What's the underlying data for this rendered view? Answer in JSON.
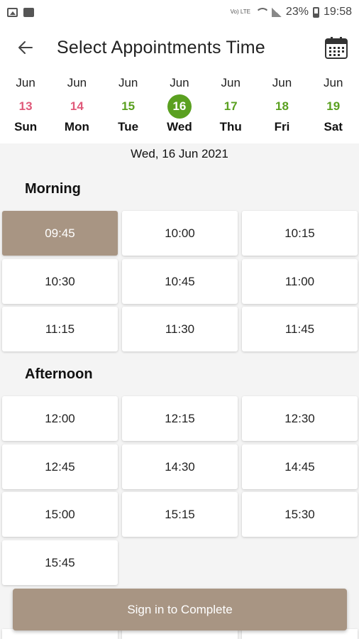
{
  "status_bar": {
    "volte": "Vo) LTE",
    "battery": "23%",
    "time": "19:58"
  },
  "header": {
    "title": "Select Appointments Time"
  },
  "week": [
    {
      "month": "Jun",
      "day": "13",
      "weekday": "Sun",
      "state": "past"
    },
    {
      "month": "Jun",
      "day": "14",
      "weekday": "Mon",
      "state": "past"
    },
    {
      "month": "Jun",
      "day": "15",
      "weekday": "Tue",
      "state": "future"
    },
    {
      "month": "Jun",
      "day": "16",
      "weekday": "Wed",
      "state": "selected"
    },
    {
      "month": "Jun",
      "day": "17",
      "weekday": "Thu",
      "state": "future"
    },
    {
      "month": "Jun",
      "day": "18",
      "weekday": "Fri",
      "state": "future"
    },
    {
      "month": "Jun",
      "day": "19",
      "weekday": "Sat",
      "state": "future"
    }
  ],
  "selected_date": "Wed, 16 Jun 2021",
  "morning": {
    "title": "Morning",
    "slots": [
      "09:45",
      "10:00",
      "10:15",
      "10:30",
      "10:45",
      "11:00",
      "11:15",
      "11:30",
      "11:45"
    ]
  },
  "afternoon": {
    "title": "Afternoon",
    "slots": [
      "12:00",
      "12:15",
      "12:30",
      "12:45",
      "14:30",
      "14:45",
      "15:00",
      "15:15",
      "15:30",
      "15:45"
    ]
  },
  "selected_slot": "09:45",
  "cta_label": "Sign in to Complete",
  "colors": {
    "accent_green": "#5aa020",
    "past_pink": "#e05a7a",
    "selected_slot": "#a89583",
    "button": "#a89583"
  }
}
